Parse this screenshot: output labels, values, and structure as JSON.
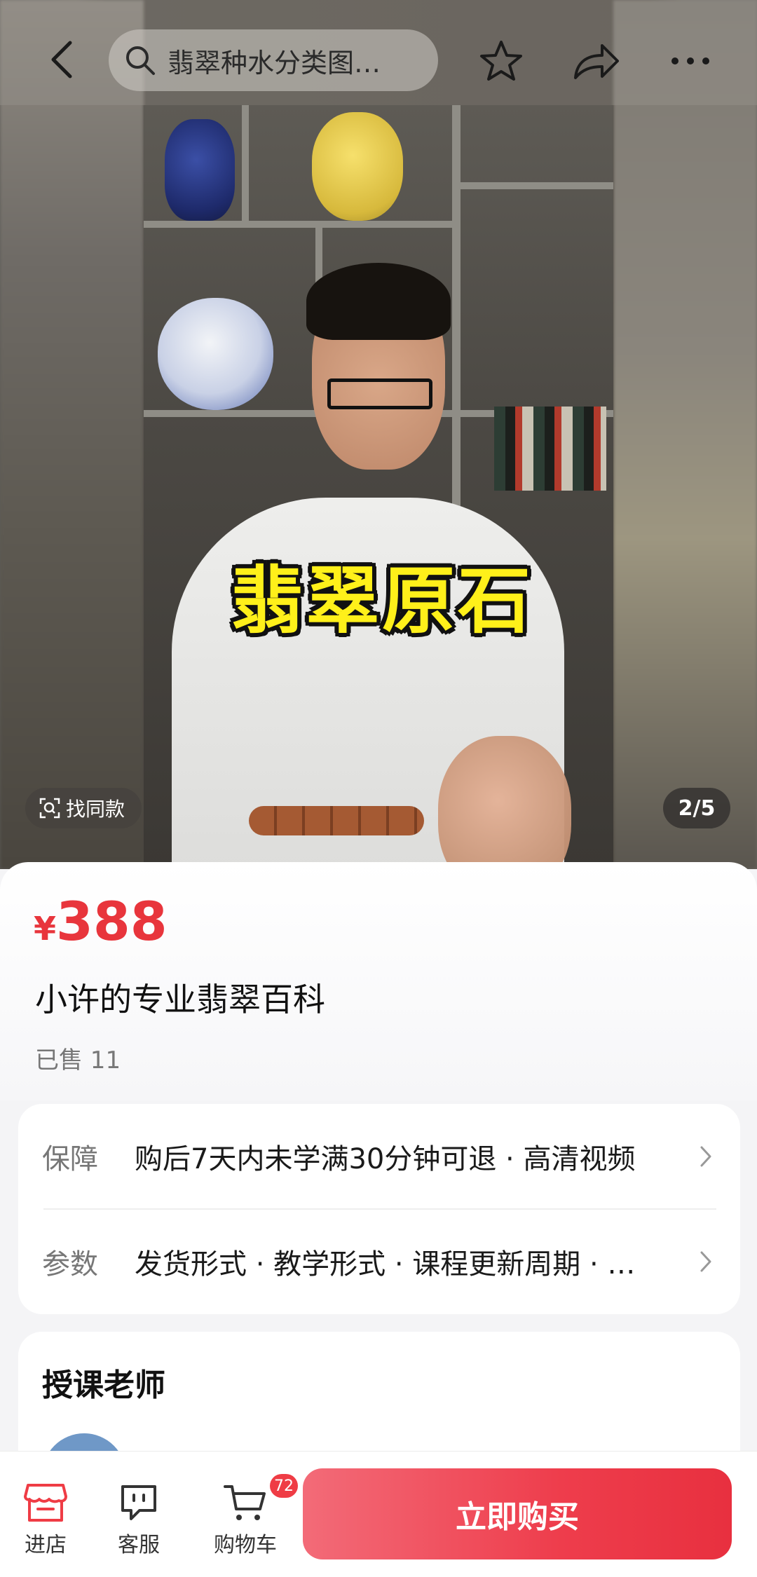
{
  "header": {
    "search_text": "翡翠种水分类图…",
    "icons": [
      "back-icon",
      "search-icon",
      "star-icon",
      "share-icon",
      "more-icon"
    ]
  },
  "media": {
    "caption": "翡翠原石",
    "find_same_label": "找同款",
    "pager": "2/5"
  },
  "product": {
    "currency_symbol": "¥",
    "price": "388",
    "title": "小许的专业翡翠百科",
    "sold": "已售 11",
    "price_color": "#e8353c"
  },
  "info": {
    "guarantee_label": "保障",
    "guarantee_value": "购后7天内未学满30分钟可退 · 高清视频",
    "params_label": "参数",
    "params_value": "发货形式 · 教学形式 · 课程更新周期 · …"
  },
  "teacher": {
    "title": "授课老师"
  },
  "bottom_bar": {
    "store_label": "进店",
    "service_label": "客服",
    "cart_label": "购物车",
    "cart_count": "72",
    "buy_label": "立即购买",
    "accent": "#ee3d4c"
  }
}
